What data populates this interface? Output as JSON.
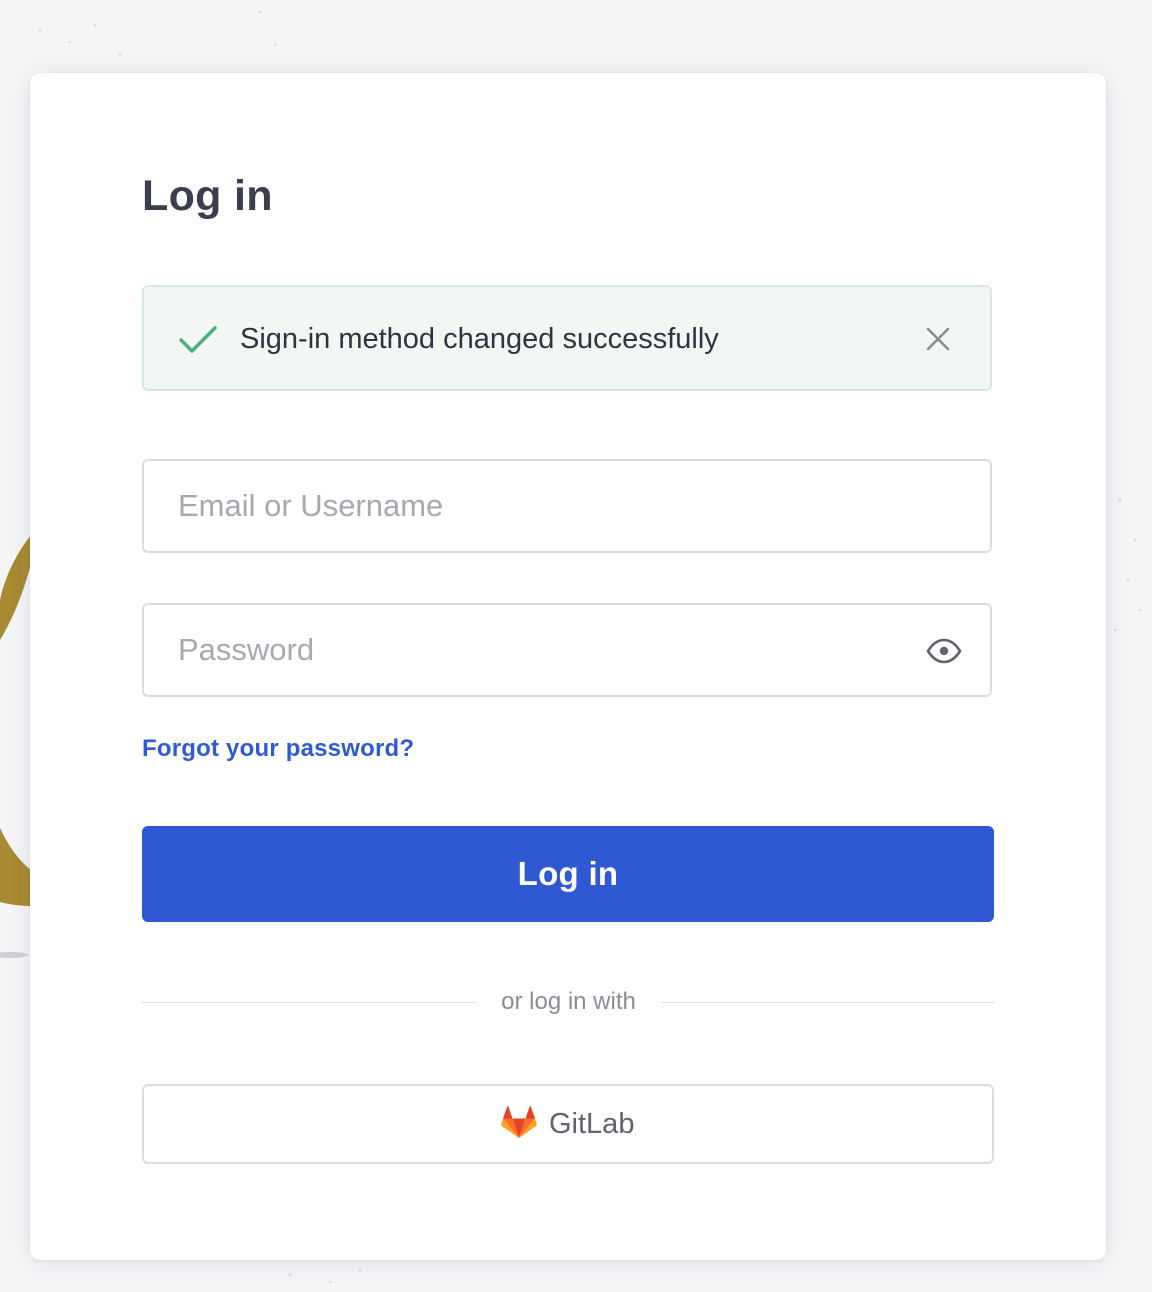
{
  "page": {
    "title": "Log in"
  },
  "alert": {
    "message": "Sign-in method changed successfully",
    "status": "success",
    "icon": "check-icon",
    "close_icon": "close-icon"
  },
  "form": {
    "email": {
      "placeholder": "Email or Username",
      "value": ""
    },
    "password": {
      "placeholder": "Password",
      "value": "",
      "toggle_icon": "eye-icon"
    },
    "forgot_link": "Forgot your password?",
    "submit_label": "Log in"
  },
  "alternate": {
    "divider_text": "or log in with",
    "providers": [
      {
        "label": "GitLab",
        "icon": "gitlab-logo-icon"
      }
    ]
  },
  "colors": {
    "primary": "#2f59d3",
    "link": "#2f5ad3",
    "success_check": "#4caf7d",
    "alert_bg": "#f2f7f4",
    "heading": "#3b3e4e"
  }
}
